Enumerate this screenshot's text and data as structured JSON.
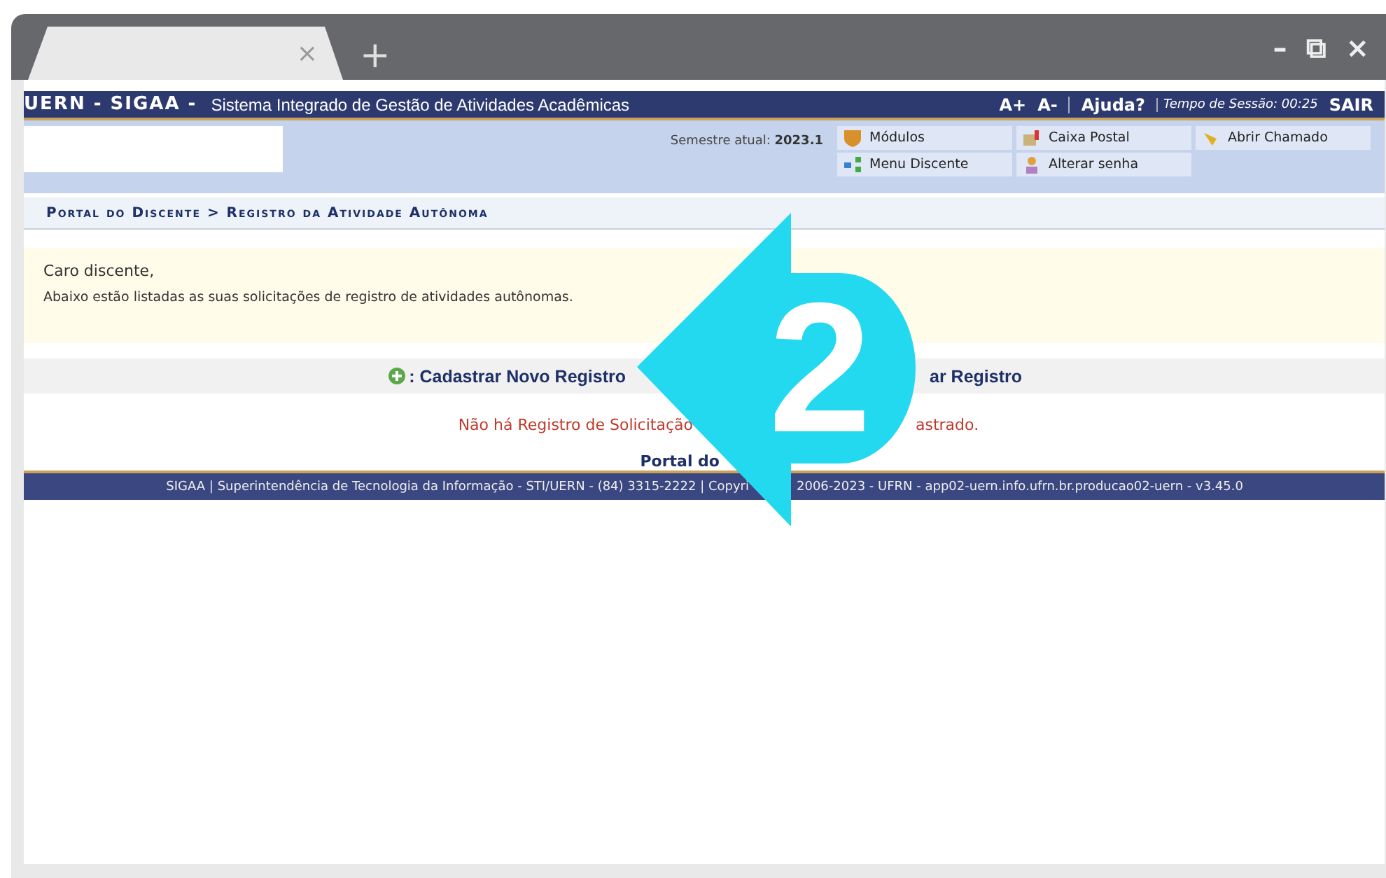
{
  "browser": {
    "tab_close": "×",
    "new_tab": "+",
    "controls": [
      "–",
      "⧉",
      "×"
    ]
  },
  "header": {
    "brand": "UERN - SIGAA -",
    "system": "Sistema Integrado de Gestão de Atividades Acadêmicas",
    "font_up": "A+",
    "font_down": "A-",
    "help": "Ajuda?",
    "session_label": "Tempo de Sessão: 00:25",
    "logout": "SAIR"
  },
  "info": {
    "semester_label": "Semestre atual:",
    "semester": "2023.1",
    "menu": [
      {
        "label": "Módulos",
        "kind": "modules"
      },
      {
        "label": "Caixa Postal",
        "kind": "mail"
      },
      {
        "label": "Abrir Chamado",
        "kind": "ticket"
      },
      {
        "label": "Menu Discente",
        "kind": "menu"
      },
      {
        "label": "Alterar senha",
        "kind": "password"
      }
    ]
  },
  "breadcrumb": "Portal do Discente > Registro da Atividade Autônoma",
  "notice": {
    "greeting": "Caro discente,",
    "text": "Abaixo estão listadas as suas solicitações de registro de atividades autônomas."
  },
  "actions": [
    {
      "label": ": Cadastrar Novo Registro",
      "kind": "add"
    },
    {
      "label": "ar Registro",
      "kind": "partial"
    }
  ],
  "empty_message": [
    "Não há Registro de Solicitação",
    "astrado."
  ],
  "portal_link": "Portal do",
  "footer": [
    "SIGAA | Superintendência de Tecnologia da Informação - STI/UERN - (84) 3315-2222 | Copyri",
    "2006-2023 - UFRN - app02-uern.info.ufrn.br.producao02-uern - v3.45.0"
  ],
  "overlay": {
    "step": "2"
  }
}
